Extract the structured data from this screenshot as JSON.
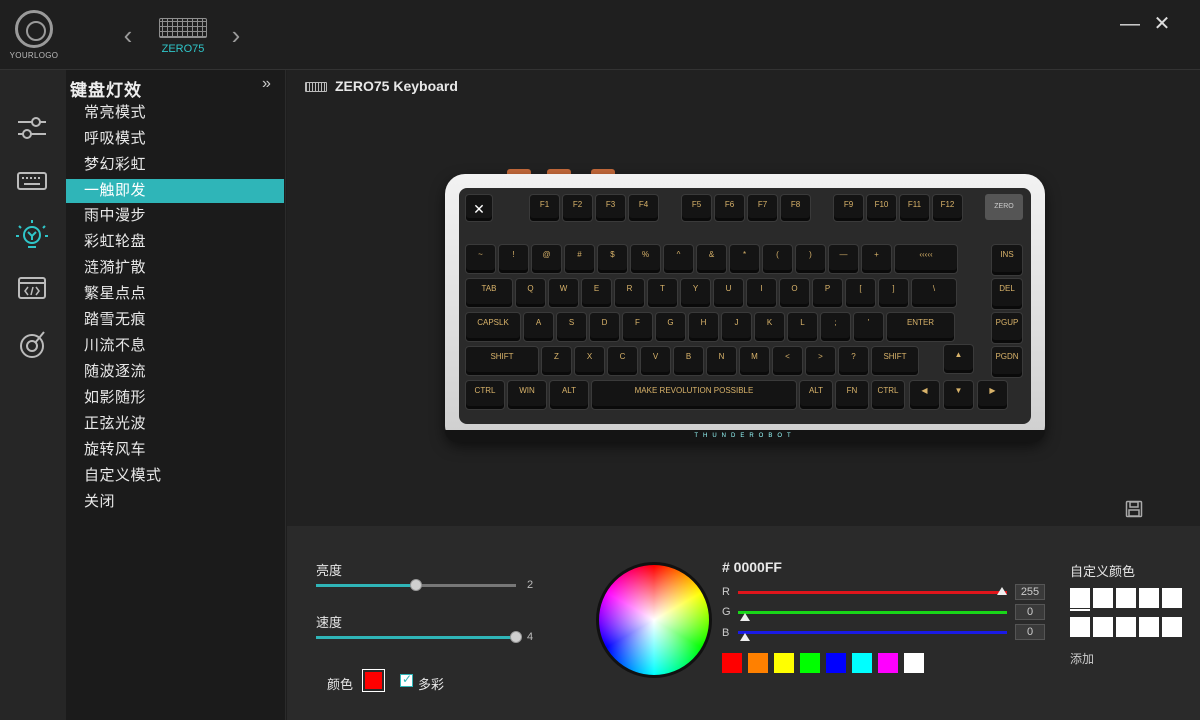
{
  "app": {
    "logo_text": "YOURLOGO",
    "device_label": "ZERO75",
    "minimize_glyph": "—",
    "close_glyph": "✕",
    "prev_glyph": "‹",
    "next_glyph": "›"
  },
  "rail": {
    "icons": [
      "sliders-icon",
      "keyboard-icon",
      "light-bulb-icon",
      "macro-icon",
      "performance-icon"
    ],
    "active": "light-bulb-icon",
    "accent": "#2fc6c9"
  },
  "effects": {
    "title": "键盘灯效",
    "collapse_glyph": "»",
    "items": [
      "常亮模式",
      "呼吸模式",
      "梦幻彩虹",
      "一触即发",
      "雨中漫步",
      "彩虹轮盘",
      "涟漪扩散",
      "繁星点点",
      "踏雪无痕",
      "川流不息",
      "随波逐流",
      "如影随形",
      "正弦光波",
      "旋转风车",
      "自定义模式",
      "关闭"
    ],
    "active_index": 3
  },
  "main": {
    "title": "ZERO75 Keyboard",
    "keyboard_brand": "THUNDEROBOT",
    "space_legend": "MAKE REVOLUTION POSSIBLE",
    "badge": "ZERO"
  },
  "controls": {
    "brightness_label": "亮度",
    "brightness_value": "2",
    "brightness_fraction": 0.5,
    "speed_label": "速度",
    "speed_value": "4",
    "speed_fraction": 1.0,
    "color_label": "颜色",
    "color_value": "#ff0000",
    "multicolor_label": "多彩",
    "multicolor_checked": true
  },
  "picker": {
    "hex": "# 0000FF",
    "r_label": "R",
    "r_value": "255",
    "g_label": "G",
    "g_value": "0",
    "b_label": "B",
    "b_value": "0",
    "presets": [
      "#ff0000",
      "#ff8000",
      "#ffff00",
      "#00ff00",
      "#0000ff",
      "#00ffff",
      "#ff00ff",
      "#ffffff"
    ]
  },
  "custom": {
    "title": "自定义颜色",
    "add_label": "添加"
  }
}
